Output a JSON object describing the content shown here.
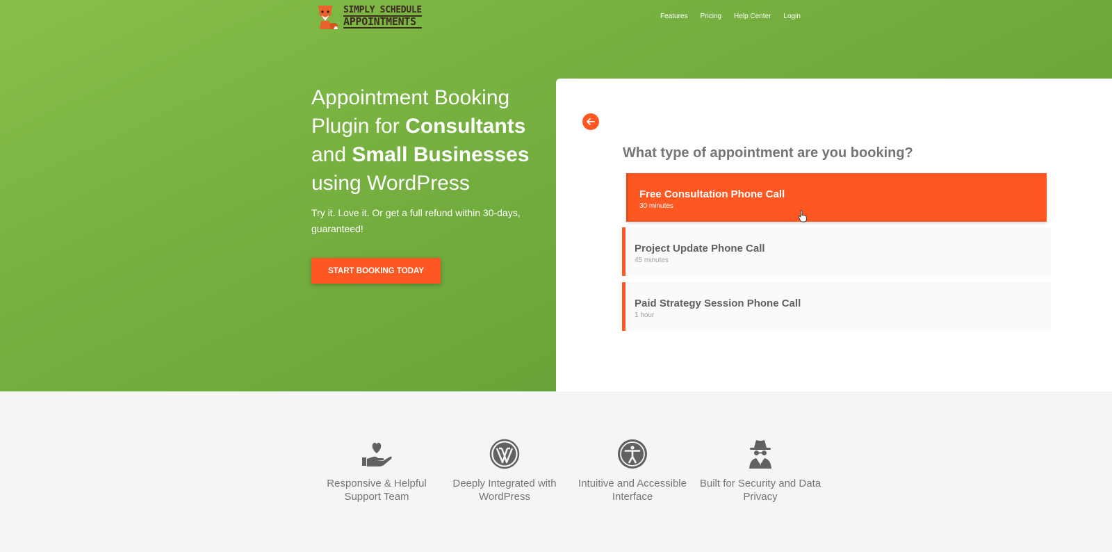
{
  "brand": {
    "line1": "SIMPLY SCHEDULE",
    "line2": "APPOINTMENTS"
  },
  "nav": [
    {
      "label": "Features"
    },
    {
      "label": "Pricing"
    },
    {
      "label": "Help Center"
    },
    {
      "label": "Login"
    }
  ],
  "hero": {
    "title_part1": "Appointment Booking Plugin for ",
    "title_bold1": "Consultants",
    "title_part2": " and ",
    "title_bold2": "Small Businesses",
    "title_part3": " using WordPress",
    "subtitle": "Try it. Love it. Or get a full refund within 30-days, guaranteed!",
    "cta_label": "START BOOKING TODAY"
  },
  "booking": {
    "back_icon": "arrow-left-icon",
    "question": "What type of appointment are you booking?",
    "appointments": [
      {
        "name": "Free Consultation Phone Call",
        "duration": "30 minutes",
        "selected": true
      },
      {
        "name": "Project Update Phone Call",
        "duration": "45 minutes",
        "selected": false
      },
      {
        "name": "Paid Strategy Session Phone Call",
        "duration": "1 hour",
        "selected": false
      }
    ]
  },
  "features": [
    {
      "icon": "heart-hand-icon",
      "label": "Responsive & Helpful Support Team"
    },
    {
      "icon": "wordpress-icon",
      "label": "Deeply Integrated with WordPress"
    },
    {
      "icon": "accessibility-icon",
      "label": "Intuitive and Accessible Interface"
    },
    {
      "icon": "spy-icon",
      "label": "Built for Security and Data Privacy"
    }
  ],
  "colors": {
    "accent": "#ff5722",
    "hero_green": "#72ad3e"
  }
}
